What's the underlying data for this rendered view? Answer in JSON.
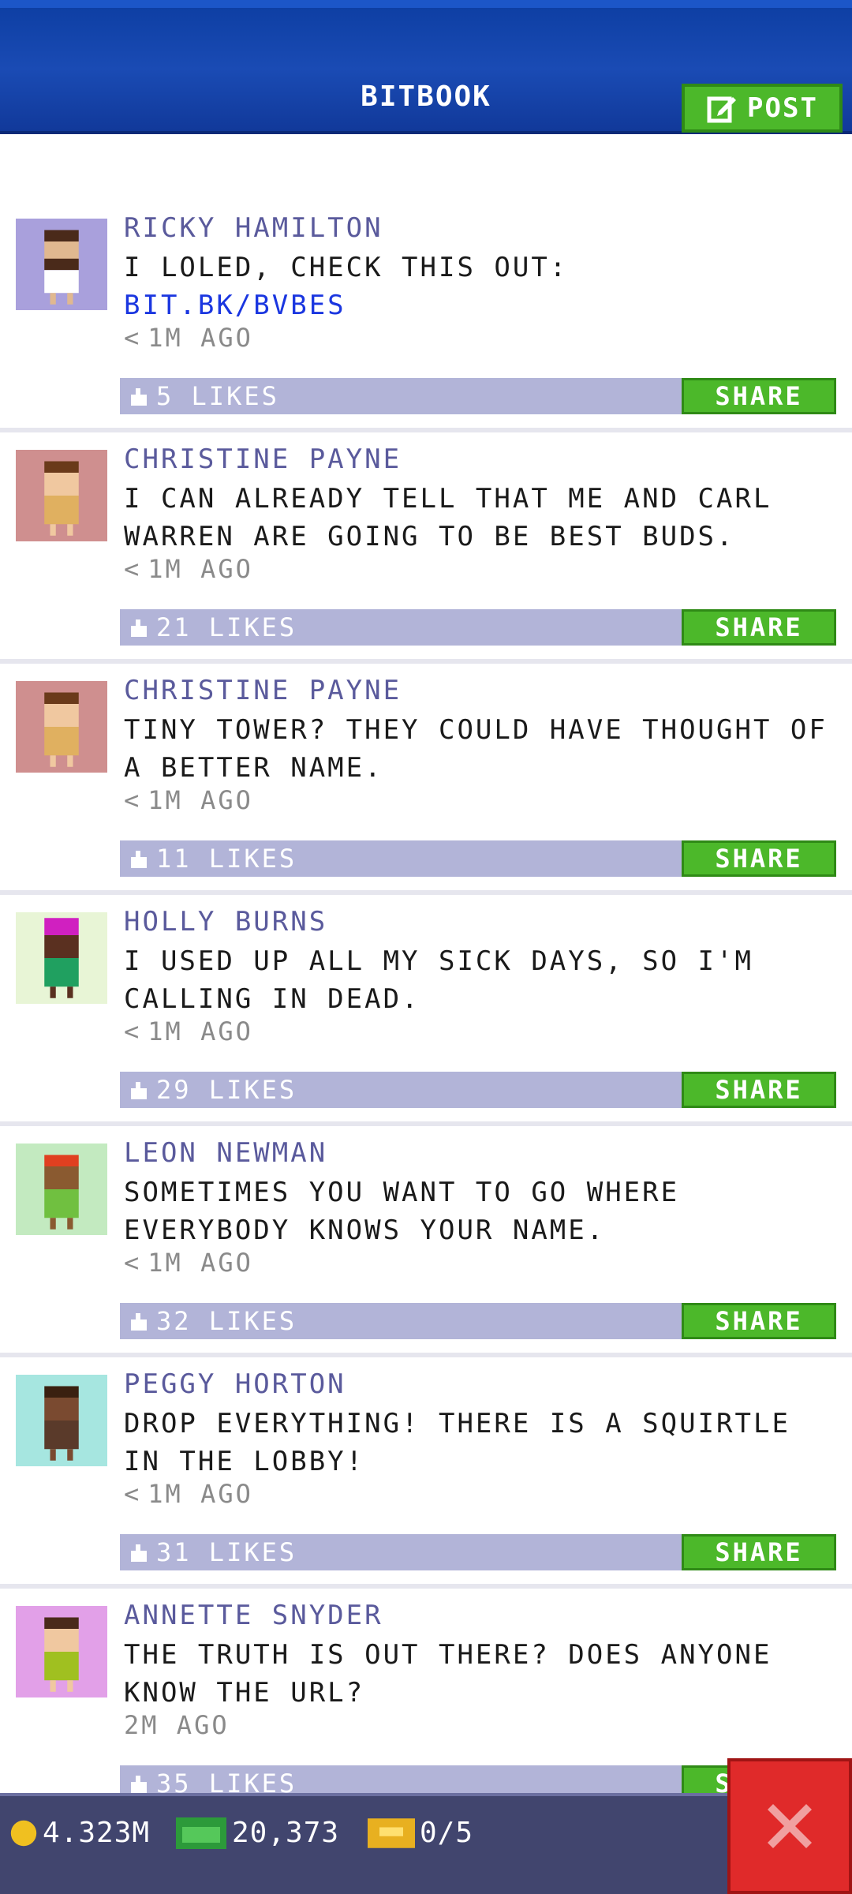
{
  "header": {
    "title": "BITBOOK",
    "post_label": "POST"
  },
  "posts": [
    {
      "name": "RICKY HAMILTON",
      "message": "I LOLED, CHECK THIS OUT:",
      "link": "BIT.BK/BVBES",
      "time": "1M AGO",
      "likes": "5 LIKES",
      "share": "SHARE",
      "avatar_bg": "#a9a0dc"
    },
    {
      "name": "CHRISTINE PAYNE",
      "message": "I CAN ALREADY TELL THAT ME AND CARL WARREN ARE GOING TO BE BEST BUDS.",
      "link": "",
      "time": "1M AGO",
      "likes": "21 LIKES",
      "share": "SHARE",
      "avatar_bg": "#cf8f8f"
    },
    {
      "name": "CHRISTINE PAYNE",
      "message": "TINY TOWER? THEY COULD HAVE THOUGHT OF A BETTER NAME.",
      "link": "",
      "time": "1M AGO",
      "likes": "11 LIKES",
      "share": "SHARE",
      "avatar_bg": "#cf8f8f"
    },
    {
      "name": "HOLLY BURNS",
      "message": "I USED UP ALL MY SICK DAYS, SO I'M CALLING IN DEAD.",
      "link": "",
      "time": "1M AGO",
      "likes": "29 LIKES",
      "share": "SHARE",
      "avatar_bg": "#e8f5d6"
    },
    {
      "name": "LEON NEWMAN",
      "message": "SOMETIMES YOU WANT TO GO WHERE EVERYBODY KNOWS YOUR NAME.",
      "link": "",
      "time": "1M AGO",
      "likes": "32 LIKES",
      "share": "SHARE",
      "avatar_bg": "#c3eac0"
    },
    {
      "name": "PEGGY HORTON",
      "message": "DROP EVERYTHING! THERE IS A SQUIRTLE IN THE LOBBY!",
      "link": "",
      "time": "1M AGO",
      "likes": "31 LIKES",
      "share": "SHARE",
      "avatar_bg": "#a6e6e0"
    },
    {
      "name": "ANNETTE SNYDER",
      "message": "THE TRUTH IS OUT THERE? DOES ANYONE KNOW THE URL?",
      "link": "",
      "time": "2M AGO",
      "likes": "35 LIKES",
      "share": "SHARE",
      "avatar_bg": "#e2a0e8"
    }
  ],
  "footer": {
    "coins": "4.323M",
    "bux": "20,373",
    "tickets": "0/5"
  },
  "colors": {
    "accent_green": "#4cb82a",
    "header_blue": "#1a4bb4",
    "close_red": "#e02a2a"
  }
}
